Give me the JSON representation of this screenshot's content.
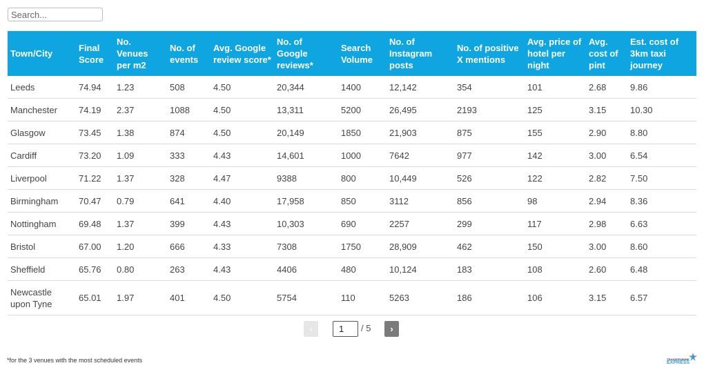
{
  "search": {
    "placeholder": "Search...",
    "value": ""
  },
  "table": {
    "columns": [
      "Town/City",
      "Final Score",
      "No. Venues per m2",
      "No. of events",
      "Avg. Google review score*",
      "No. of Google reviews*",
      "Search Volume",
      "No. of Instagram posts",
      "No. of positive X mentions",
      "Avg. price of hotel per night",
      "Avg. cost of pint",
      "Est. cost of 3km taxi journey"
    ],
    "rows": [
      [
        "Leeds",
        "74.94",
        "1.23",
        "508",
        "4.50",
        "20,344",
        "1400",
        "12,142",
        "354",
        "101",
        "2.68",
        "9.86"
      ],
      [
        "Manchester",
        "74.19",
        "2.37",
        "1088",
        "4.50",
        "13,311",
        "5200",
        "26,495",
        "2193",
        "125",
        "3.15",
        "10.30"
      ],
      [
        "Glasgow",
        "73.45",
        "1.38",
        "874",
        "4.50",
        "20,149",
        "1850",
        "21,903",
        "875",
        "155",
        "2.90",
        "8.80"
      ],
      [
        "Cardiff",
        "73.20",
        "1.09",
        "333",
        "4.43",
        "14,601",
        "1000",
        "7642",
        "977",
        "142",
        "3.00",
        "6.54"
      ],
      [
        "Liverpool",
        "71.22",
        "1.37",
        "328",
        "4.47",
        "9388",
        "800",
        "10,449",
        "526",
        "122",
        "2.82",
        "7.50"
      ],
      [
        "Birmingham",
        "70.47",
        "0.79",
        "641",
        "4.40",
        "17,958",
        "850",
        "3112",
        "856",
        "98",
        "2.94",
        "8.36"
      ],
      [
        "Nottingham",
        "69.48",
        "1.37",
        "399",
        "4.43",
        "10,303",
        "690",
        "2257",
        "299",
        "117",
        "2.98",
        "6.63"
      ],
      [
        "Bristol",
        "67.00",
        "1.20",
        "666",
        "4.33",
        "7308",
        "1750",
        "28,909",
        "462",
        "150",
        "3.00",
        "8.60"
      ],
      [
        "Sheffield",
        "65.76",
        "0.80",
        "263",
        "4.43",
        "4406",
        "480",
        "10,124",
        "183",
        "108",
        "2.60",
        "6.48"
      ],
      [
        "Newcastle upon Tyne",
        "65.01",
        "1.97",
        "401",
        "4.50",
        "5754",
        "110",
        "5263",
        "186",
        "106",
        "3.15",
        "6.57"
      ]
    ]
  },
  "pagination": {
    "prev_label": "‹",
    "next_label": "›",
    "current_page": "1",
    "total_label": "/ 5"
  },
  "footnote": "*for the 3 venues with the most scheduled events",
  "logo": {
    "line1": "TRANSPENNINE",
    "line2": "EXPRESS"
  },
  "colors": {
    "header_bg": "#0ea5e0",
    "header_text": "#ffffff",
    "row_border": "#d9d9d9"
  }
}
